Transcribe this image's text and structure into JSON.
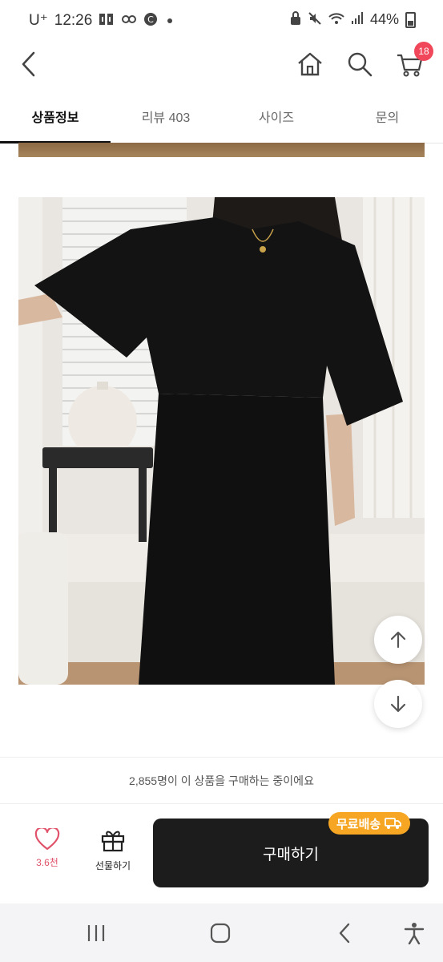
{
  "status_bar": {
    "carrier": "U⁺",
    "time": "12:26",
    "battery": "44%",
    "icons": [
      "notification-app-icon",
      "notification-character-icon",
      "c-app-icon",
      "dot-icon",
      "lock-icon",
      "mute-icon",
      "wifi-icon",
      "signal-icon",
      "battery-icon"
    ]
  },
  "header": {
    "icons": [
      "back-icon",
      "home-icon",
      "search-icon",
      "cart-icon"
    ],
    "cart_count": "18"
  },
  "tabs": [
    {
      "label": "상품정보",
      "active": true
    },
    {
      "label": "리뷰 403",
      "active": false
    },
    {
      "label": "사이즈",
      "active": false
    },
    {
      "label": "문의",
      "active": false
    }
  ],
  "scroll_buttons": {
    "up_icon": "arrow-up-icon",
    "down_icon": "arrow-down-icon"
  },
  "buyers_note": "2,855명이 이 상품을 구매하는 중이에요",
  "bottom_bar": {
    "like_count": "3.6천",
    "gift_label": "선물하기",
    "buy_label": "구매하기",
    "free_shipping_badge": "무료배송",
    "accent_color": "#f6a623",
    "like_color": "#e0536a"
  },
  "nav_bar": {
    "icons": [
      "recent-apps-icon",
      "home-button-icon",
      "back-nav-icon",
      "accessibility-icon"
    ]
  }
}
